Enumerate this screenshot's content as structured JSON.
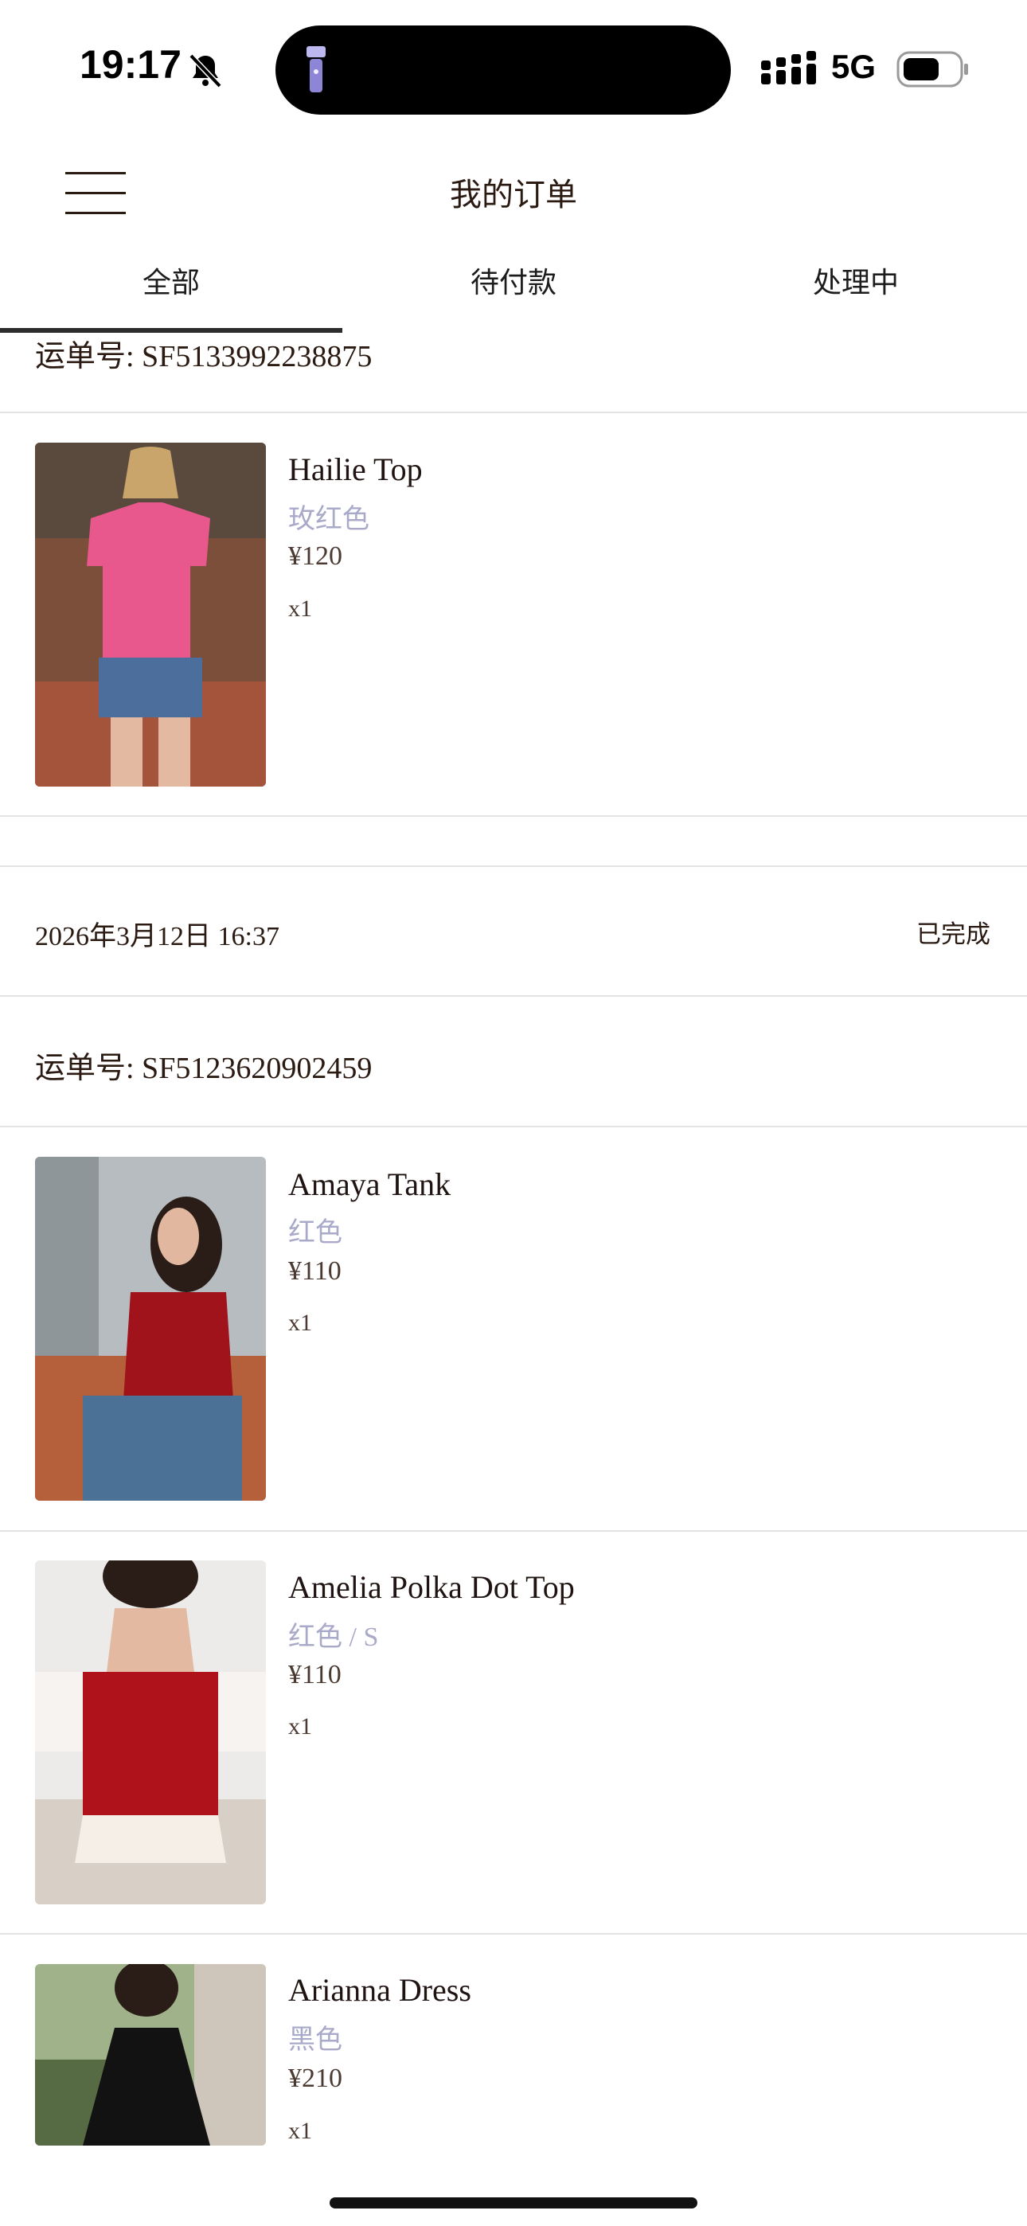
{
  "status_bar": {
    "time": "19:17",
    "network": "5G"
  },
  "header": {
    "title": "我的订单"
  },
  "tabs": [
    {
      "label": "全部",
      "active": true
    },
    {
      "label": "待付款",
      "active": false
    },
    {
      "label": "处理中",
      "active": false
    }
  ],
  "orders": [
    {
      "waybill": "运单号: SF5133992238875",
      "items": [
        {
          "name": "Hailie Top",
          "variant": "玫红色",
          "price": "¥120",
          "qty": "x1",
          "image": "pink-tshirt-photo"
        }
      ]
    },
    {
      "date": "2026年3月12日 16:37",
      "status": "已完成",
      "waybill": "运单号: SF5123620902459",
      "items": [
        {
          "name": "Amaya Tank",
          "variant": "红色",
          "price": "¥110",
          "qty": "x1",
          "image": "red-tank-photo"
        },
        {
          "name": "Amelia Polka Dot Top",
          "variant": "红色 / S",
          "price": "¥110",
          "qty": "x1",
          "image": "red-tube-top-photo"
        },
        {
          "name": "Arianna Dress",
          "variant": "黑色",
          "price": "¥210",
          "qty": "x1",
          "image": "black-dress-photo"
        }
      ]
    }
  ],
  "colors": {
    "text": "#2a1a12",
    "variant": "#a9a9c9",
    "separator": "#e3e3e3",
    "tab_indicator": "#2d2d2d"
  },
  "icons": [
    "bell-slash-icon",
    "flashlight-icon",
    "signal-icon",
    "battery-icon",
    "menu-icon"
  ]
}
